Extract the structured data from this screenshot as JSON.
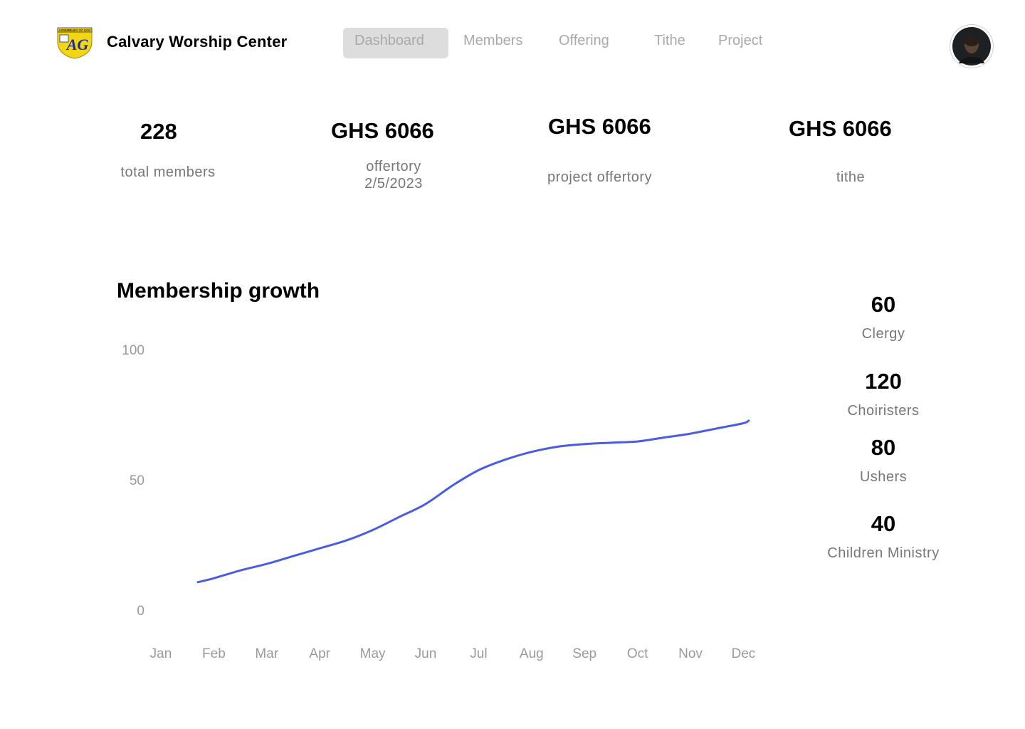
{
  "header": {
    "brand": "Calvary Worship Center",
    "logo": {
      "banner_text": "ASSEMBLIES OF GOD",
      "letters": "AG",
      "colors": {
        "shield": "#f2d516",
        "letters": "#1c2f8c"
      }
    },
    "nav": [
      {
        "label": "Dashboard",
        "active": true
      },
      {
        "label": "Members",
        "active": false
      },
      {
        "label": "Offering",
        "active": false
      },
      {
        "label": "Tithe",
        "active": false
      },
      {
        "label": "Project",
        "active": false
      }
    ],
    "avatar": "user-avatar"
  },
  "stats": [
    {
      "value": "228",
      "label": "total members"
    },
    {
      "value": "GHS 6066",
      "label": "offertory",
      "sublabel": "2/5/2023"
    },
    {
      "value": "GHS 6066",
      "label": "project offertory"
    },
    {
      "value": "GHS 6066",
      "label": "tithe"
    }
  ],
  "chart_data": {
    "type": "line",
    "title": "Membership growth",
    "categories": [
      "Jan",
      "Feb",
      "Mar",
      "Apr",
      "May",
      "Jun",
      "Jul",
      "Aug",
      "Sep",
      "Oct",
      "Nov",
      "Dec"
    ],
    "y_ticks": [
      0,
      50,
      100
    ],
    "ylim": [
      0,
      100
    ],
    "grid": false,
    "series": [
      {
        "color": "#4a5de0",
        "x": [
          0.7,
          1.0,
          1.5,
          2.0,
          2.5,
          3.0,
          3.5,
          4.0,
          4.5,
          5.0,
          5.5,
          6.0,
          6.5,
          7.0,
          7.5,
          8.0,
          8.5,
          9.0,
          9.5,
          10.0,
          10.5,
          11.0,
          11.1
        ],
        "values": [
          11,
          12.5,
          15.5,
          18,
          21,
          24,
          27,
          31,
          36,
          41,
          48,
          54,
          58,
          61,
          63,
          64,
          64.5,
          65,
          66.5,
          68,
          70,
          72,
          73
        ]
      }
    ]
  },
  "groups": [
    {
      "value": "60",
      "label": "Clergy"
    },
    {
      "value": "120",
      "label": "Choiristers"
    },
    {
      "value": "80",
      "label": "Ushers"
    },
    {
      "value": "40",
      "label": "Children Ministry"
    }
  ]
}
